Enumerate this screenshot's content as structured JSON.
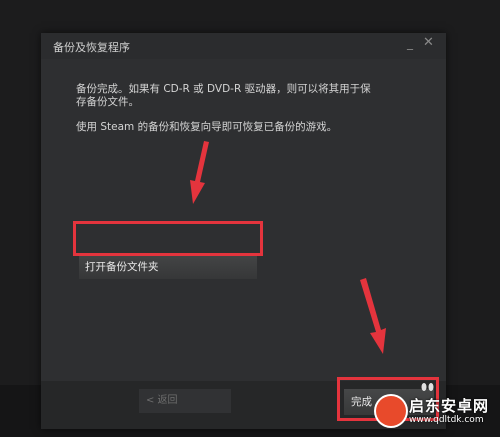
{
  "dialog": {
    "title": "备份及恢复程序",
    "minimize_glyph": "_",
    "close_glyph": "✕"
  },
  "content": {
    "line1": "备份完成。如果有 CD-R 或 DVD-R 驱动器，则可以将其用于保",
    "line2": "存备份文件。",
    "line3": "使用 Steam 的备份和恢复向导即可恢复已备份的游戏。",
    "open_folder_label": "打开备份文件夹"
  },
  "footer": {
    "back_label": "< 返回",
    "finish_label": "完成"
  },
  "annotations": {
    "highlight_color": "#e4343d",
    "arrow_color": "#e4343d"
  },
  "watermark": {
    "brand": "启东安卓网",
    "url": "www.qdltdk.com"
  }
}
